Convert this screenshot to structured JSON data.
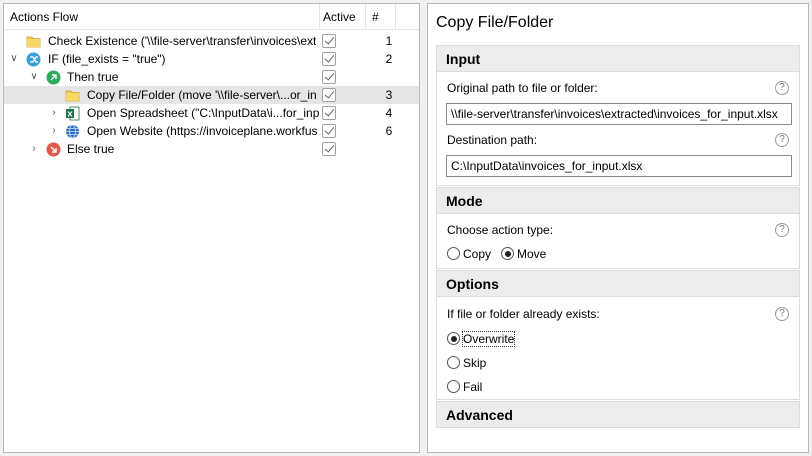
{
  "tree": {
    "columns": {
      "actions": "Actions Flow",
      "active": "Active",
      "number": "#"
    },
    "rows": [
      {
        "label": "Check Existence ('\\\\file-server\\transfer\\invoices\\ext",
        "number": "1"
      },
      {
        "label": "IF (file_exists = \"true\")",
        "number": "2"
      },
      {
        "label": "Then true",
        "number": ""
      },
      {
        "label": "Copy File/Folder (move '\\\\file-server\\...or_in",
        "number": "3"
      },
      {
        "label": "Open Spreadsheet (\"C:\\InputData\\i...for_inp",
        "number": "4"
      },
      {
        "label": "Open Website (https://invoiceplane.workfus",
        "number": "6"
      },
      {
        "label": "Else true",
        "number": ""
      }
    ]
  },
  "properties": {
    "title": "Copy File/Folder",
    "input": {
      "heading": "Input",
      "source_label": "Original path to file or folder:",
      "source_value": "\\\\file-server\\transfer\\invoices\\extracted\\invoices_for_input.xlsx",
      "dest_label": "Destination path:",
      "dest_value": "C:\\InputData\\invoices_for_input.xlsx"
    },
    "mode": {
      "heading": "Mode",
      "type_label": "Choose action type:",
      "copy": "Copy",
      "move": "Move",
      "selected": "Move"
    },
    "options": {
      "heading": "Options",
      "exists_label": "If file or folder already exists:",
      "overwrite": "Overwrite",
      "skip": "Skip",
      "fail": "Fail",
      "selected": "Overwrite"
    },
    "advanced": {
      "heading": "Advanced"
    },
    "help_glyph": "?"
  },
  "icons": {
    "folder": "folder-icon",
    "if": "condition-icon",
    "then": "then-arrow-icon",
    "else": "else-icon",
    "excel": "excel-icon",
    "web": "globe-icon"
  },
  "colors": {
    "folder": "#f5c84c",
    "if": "#3aa0d8",
    "then": "#2faa5a",
    "else": "#e25a4a",
    "excel": "#1e7145",
    "web": "#2d6fc1"
  }
}
